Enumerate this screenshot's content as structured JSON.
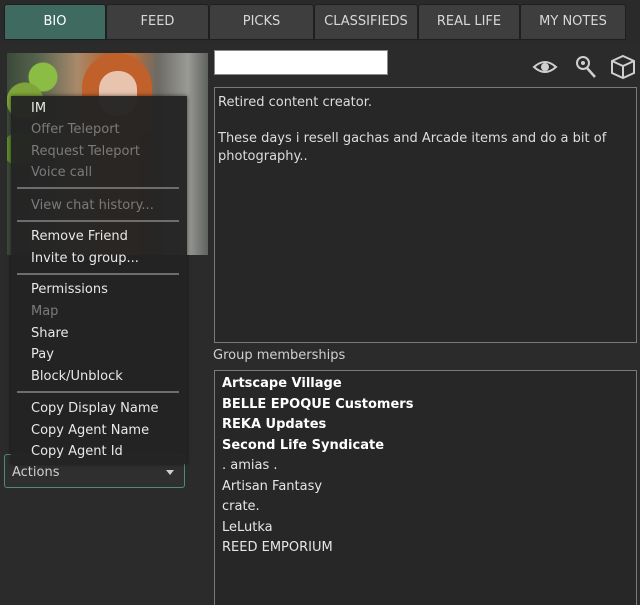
{
  "tabs": [
    {
      "label": "BIO",
      "active": true
    },
    {
      "label": "FEED",
      "active": false
    },
    {
      "label": "PICKS",
      "active": false
    },
    {
      "label": "CLASSIFIEDS",
      "active": false
    },
    {
      "label": "REAL LIFE",
      "active": false
    },
    {
      "label": "MY NOTES",
      "active": false
    }
  ],
  "profile": {
    "name_value": "",
    "bio": "Retired content creator.\n\nThese days i resell gachas and Arcade items and do a bit of photography..",
    "icons": [
      "eye-icon",
      "map-pin-icon",
      "cube-icon"
    ]
  },
  "groups": {
    "label": "Group memberships",
    "items": [
      {
        "name": "Artscape Village",
        "bold": true
      },
      {
        "name": "BELLE EPOQUE Customers",
        "bold": true
      },
      {
        "name": "REKA Updates",
        "bold": true
      },
      {
        "name": "Second Life Syndicate",
        "bold": true
      },
      {
        "name": ". amias .",
        "bold": false
      },
      {
        "name": "Artisan Fantasy",
        "bold": false
      },
      {
        "name": "crate.",
        "bold": false
      },
      {
        "name": "LeLutka",
        "bold": false
      },
      {
        "name": "REED EMPORIUM",
        "bold": false
      }
    ]
  },
  "actions": {
    "label": "Actions"
  },
  "menu": {
    "items": [
      {
        "label": "IM",
        "enabled": true
      },
      {
        "label": "Offer Teleport",
        "enabled": false
      },
      {
        "label": "Request Teleport",
        "enabled": false
      },
      {
        "label": "Voice call",
        "enabled": false
      },
      {
        "label": "View chat history...",
        "enabled": false
      },
      {
        "label": "Remove Friend",
        "enabled": true
      },
      {
        "label": "Invite to group...",
        "enabled": true
      },
      {
        "label": "Permissions",
        "enabled": true
      },
      {
        "label": "Map",
        "enabled": false
      },
      {
        "label": "Share",
        "enabled": true
      },
      {
        "label": "Pay",
        "enabled": true
      },
      {
        "label": "Block/Unblock",
        "enabled": true
      },
      {
        "label": "Copy Display Name",
        "enabled": true
      },
      {
        "label": "Copy Agent Name",
        "enabled": true
      },
      {
        "label": "Copy Agent Id",
        "enabled": true
      }
    ]
  },
  "colors": {
    "accent": "#3e6a60",
    "panel": "#2b2b2b",
    "disabled_text": "#7b7b7b"
  }
}
